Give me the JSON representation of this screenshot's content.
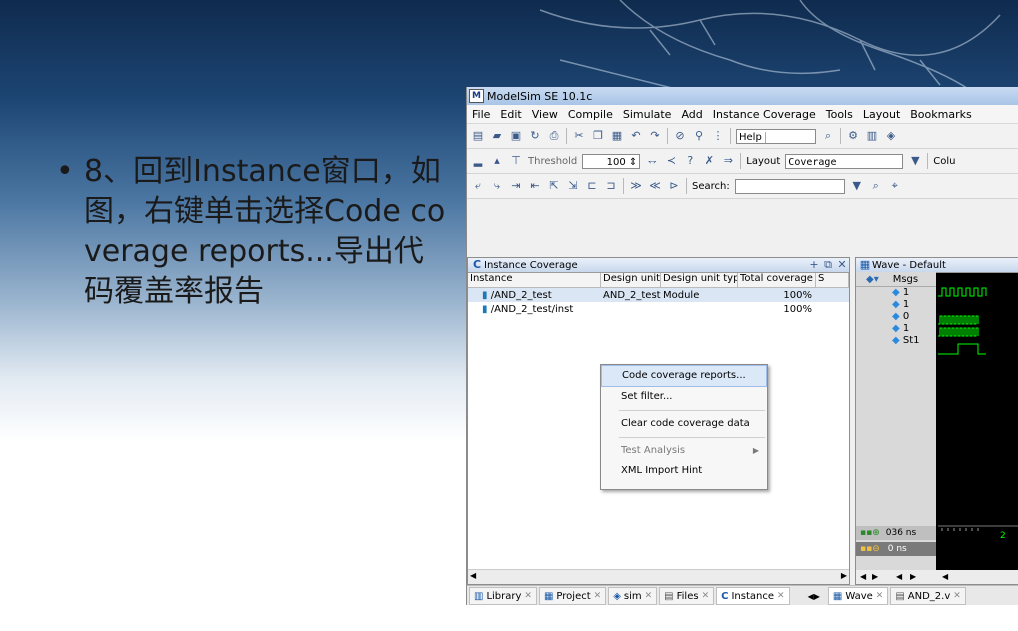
{
  "slide": {
    "bullet_char": "•",
    "bullet_text": "8、回到Instance窗口，如图，右键单击选择Code coverage reports...导出代码覆盖率报告"
  },
  "window": {
    "title": "ModelSim SE 10.1c",
    "menu": [
      "File",
      "Edit",
      "View",
      "Compile",
      "Simulate",
      "Add",
      "Instance Coverage",
      "Tools",
      "Layout",
      "Bookmarks"
    ],
    "toolbar1": {
      "help_label": "Help"
    },
    "toolbar2": {
      "threshold_label": "Threshold",
      "threshold_value": "100",
      "layout_label": "Layout",
      "layout_value": "Coverage",
      "col_label": "Colu"
    },
    "toolbar3": {
      "search_label": "Search:"
    }
  },
  "instance_pane": {
    "title": "Instance Coverage",
    "columns": [
      "Instance",
      "Design unit",
      "Design unit type",
      "Total coverage",
      "S"
    ],
    "rows": [
      {
        "instance": "/AND_2_test",
        "design_unit": "AND_2_test",
        "unit_type": "Module",
        "coverage": "100%"
      },
      {
        "instance": "/AND_2_test/inst",
        "design_unit": "",
        "unit_type": "",
        "coverage": "100%"
      }
    ]
  },
  "context_menu": {
    "items": [
      "Code coverage reports...",
      "Set filter...",
      "Clear code coverage data",
      "Test Analysis",
      "XML Import Hint"
    ]
  },
  "wave_pane": {
    "title": "Wave - Default",
    "msgs_label": "Msgs",
    "signal_values": [
      "1",
      "1",
      "0",
      "1",
      "St1"
    ],
    "cursor_time": "036 ns",
    "cursor2_time": "0 ns",
    "time_digit": "2"
  },
  "tabs": {
    "left": [
      "Library",
      "Project",
      "sim",
      "Files",
      "Instance"
    ],
    "right": [
      "Wave",
      "AND_2.v"
    ]
  },
  "colors": {
    "wave": "#00ff00",
    "accent": "#3c6ea8"
  }
}
